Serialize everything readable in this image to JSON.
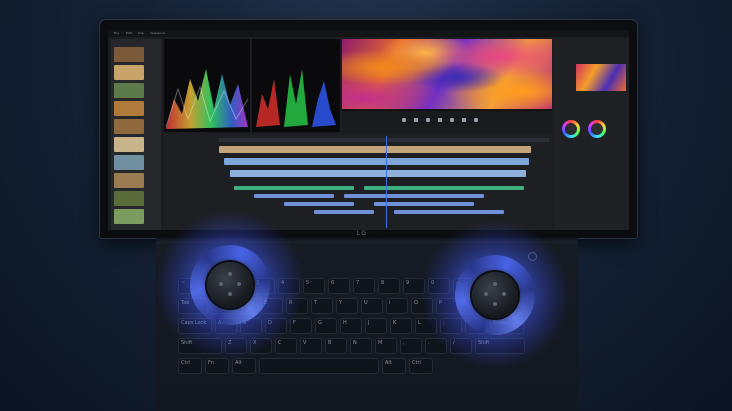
{
  "brand": {
    "logo": "LG"
  },
  "editor": {
    "menu": [
      "File",
      "Edit",
      "Clip",
      "Sequence",
      "Markers",
      "Graphics",
      "View",
      "Window",
      "Help"
    ],
    "bin_thumbs": [
      "#7a5a3a",
      "#c9a46a",
      "#5d7a4a",
      "#b07a3a",
      "#8e6a3e",
      "#c7b48b",
      "#6f8ea0",
      "#9b7b52",
      "#5a6b3c",
      "#7c9b5f",
      "#b58a5a",
      "#8a6d4b"
    ],
    "colors": {
      "accent_blue": "#3b6fe0",
      "video_clip": "#7fa6d8",
      "audio_clip": "#3fae7e",
      "audio_clip_alt": "#6f8fd8"
    }
  },
  "keyboard": {
    "row_numbers": [
      "~",
      "1",
      "2",
      "3",
      "4",
      "5",
      "6",
      "7",
      "8",
      "9",
      "0",
      "-",
      "="
    ],
    "row_top": [
      "Tab",
      "Q",
      "W",
      "E",
      "R",
      "T",
      "Y",
      "U",
      "I",
      "O",
      "P",
      "[",
      "]"
    ],
    "row_home": [
      "Caps Lock",
      "A",
      "S",
      "D",
      "F",
      "G",
      "H",
      "J",
      "K",
      "L",
      ";",
      "'",
      "Enter"
    ],
    "row_bottom": [
      "Shift",
      "Z",
      "X",
      "C",
      "V",
      "B",
      "N",
      "M",
      ",",
      ".",
      "/",
      "Shift"
    ],
    "row_mods": [
      "Ctrl",
      "Fn",
      "Alt",
      "",
      "Alt",
      "Ctrl"
    ]
  }
}
